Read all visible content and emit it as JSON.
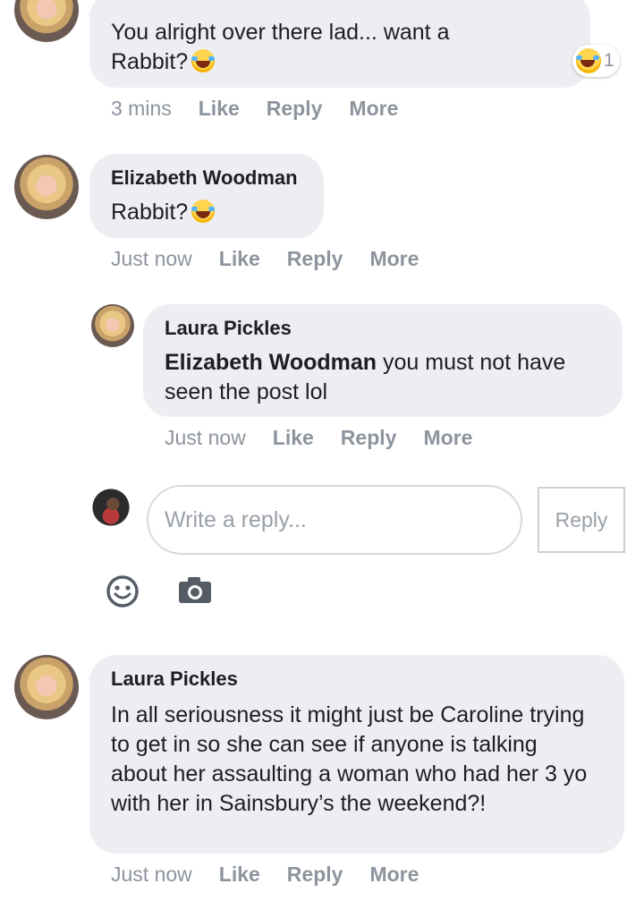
{
  "comments": [
    {
      "text": "You alright over there lad... want a Rabbit?",
      "time": "3 mins",
      "reaction_count": "1"
    },
    {
      "author": "Elizabeth Woodman",
      "text": "Rabbit?",
      "time": "Just now"
    },
    {
      "author": "Laura Pickles",
      "mention": "Elizabeth Woodman",
      "text_after_mention": " you must not have seen the post lol",
      "time": "Just now"
    },
    {
      "author": "Laura Pickles",
      "text": "In all seriousness it might just be Caroline trying to get in so she can see if anyone is talking about her assaulting a woman who had her 3 yo with her in Sainsbury’s the weekend?!",
      "time": "Just now"
    }
  ],
  "actions": {
    "like": "Like",
    "reply": "Reply",
    "more": "More"
  },
  "composer": {
    "placeholder": "Write a reply...",
    "submit_label": "Reply"
  },
  "icons": {
    "emoji_button": "smiley-icon",
    "camera_button": "camera-icon",
    "reaction": "laughing-emoji-icon"
  }
}
